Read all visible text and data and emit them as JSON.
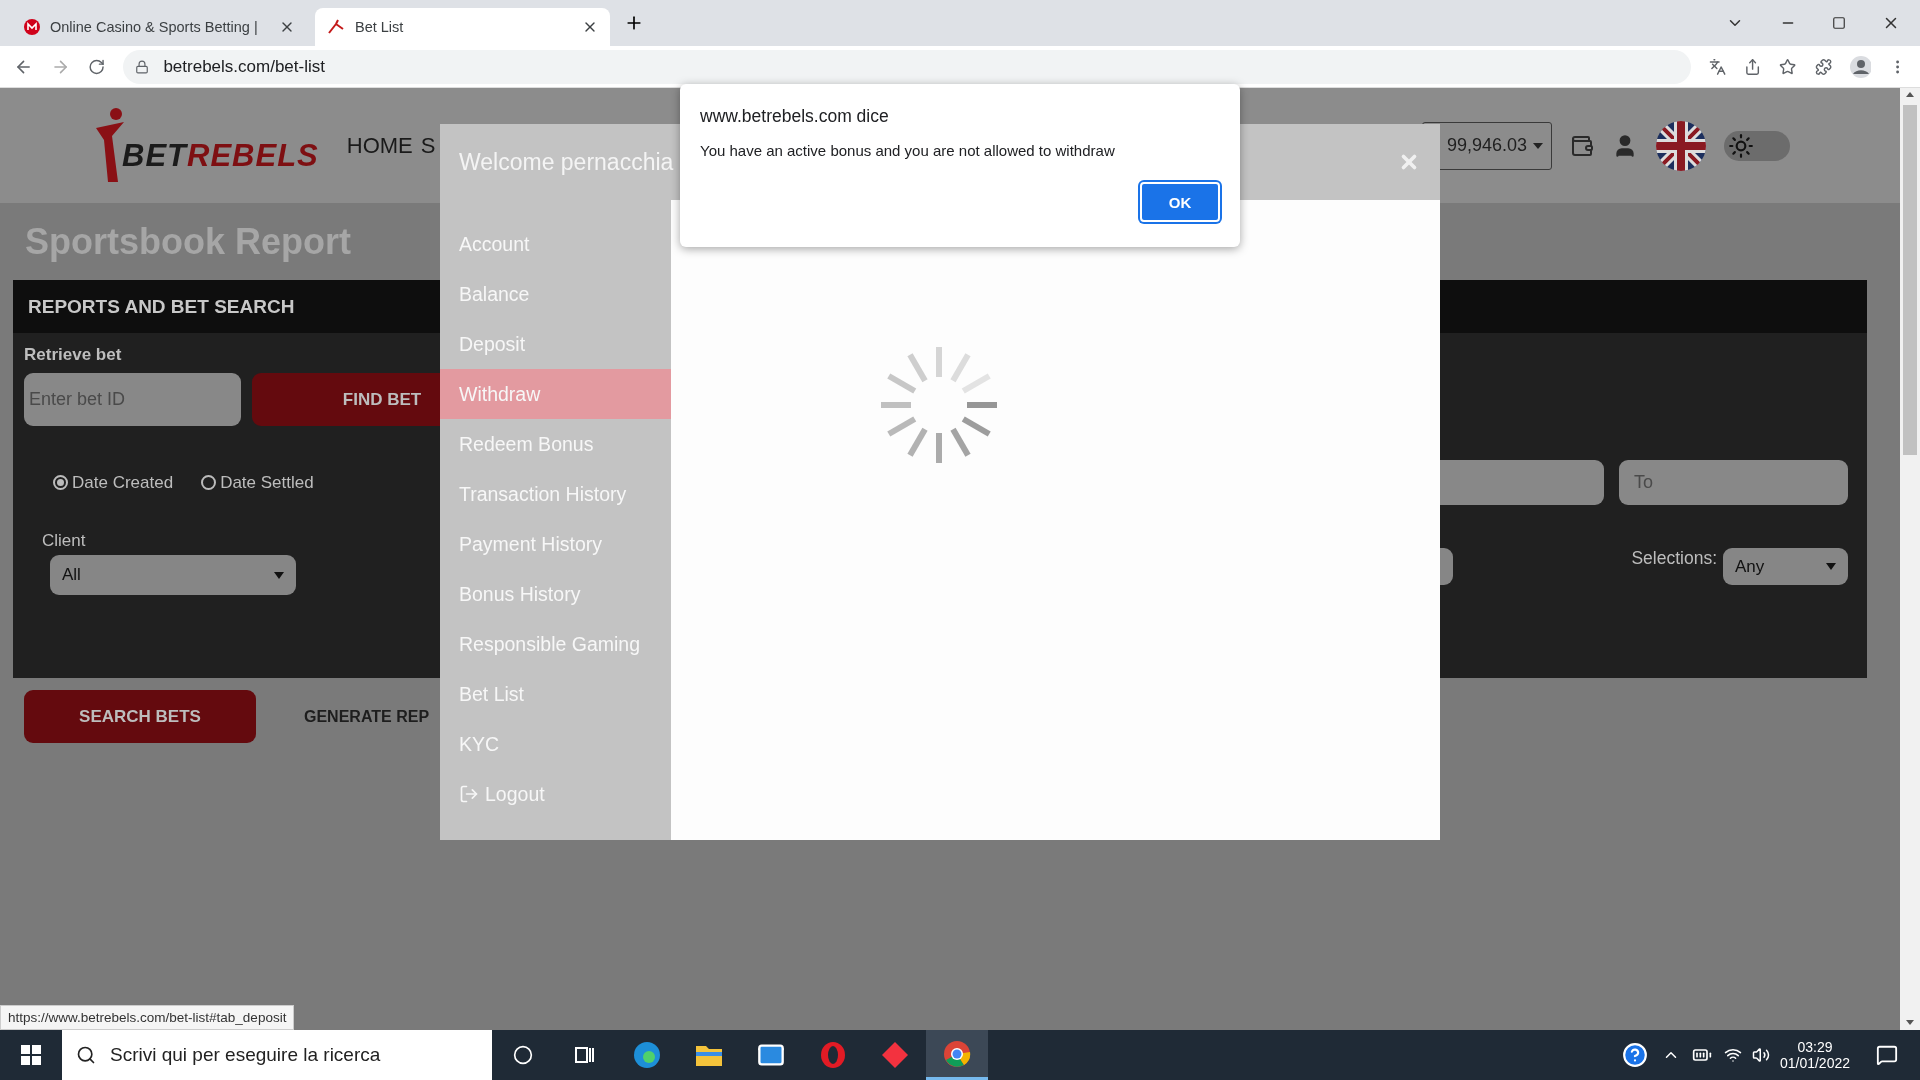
{
  "browser": {
    "tabs": [
      {
        "title": "Online Casino & Sports Betting |",
        "selected": false
      },
      {
        "title": "Bet List",
        "selected": true
      }
    ],
    "url": "betrebels.com/bet-list"
  },
  "header": {
    "brand": [
      "BET",
      "REBELS"
    ],
    "nav": [
      "HOME",
      "S"
    ],
    "balance": "99,946.03",
    "theme_toggle_on": false
  },
  "page": {
    "title": "Sportsbook Report",
    "panel_title": "REPORTS AND BET SEARCH",
    "retrieve_label": "Retrieve bet",
    "bet_id_placeholder": "Enter bet ID",
    "find_button": "FIND BET",
    "date_options": [
      {
        "label": "Date Created",
        "selected": true
      },
      {
        "label": "Date Settled",
        "selected": false
      }
    ],
    "to_placeholder": "To",
    "client_label": "Client",
    "client_value": "All",
    "selections_label": "Selections:",
    "selections_value": "Any",
    "search_button": "SEARCH BETS",
    "generate_button": "GENERATE REP"
  },
  "modal": {
    "title": "Welcome pernacchia",
    "menu": [
      {
        "label": "Account",
        "selected": false,
        "kind": "link"
      },
      {
        "label": "Balance",
        "selected": false,
        "kind": "link"
      },
      {
        "label": "Deposit",
        "selected": false,
        "kind": "link"
      },
      {
        "label": "Withdraw",
        "selected": true,
        "kind": "link"
      },
      {
        "label": "Redeem Bonus",
        "selected": false,
        "kind": "link"
      },
      {
        "label": "Transaction History",
        "selected": false,
        "kind": "link"
      },
      {
        "label": "Payment History",
        "selected": false,
        "kind": "link"
      },
      {
        "label": "Bonus History",
        "selected": false,
        "kind": "link"
      },
      {
        "label": "Responsible Gaming",
        "selected": false,
        "kind": "link"
      },
      {
        "label": "Bet List",
        "selected": false,
        "kind": "link"
      },
      {
        "label": "KYC",
        "selected": false,
        "kind": "link"
      },
      {
        "label": "Logout",
        "selected": false,
        "kind": "logout"
      }
    ]
  },
  "alert": {
    "title": "www.betrebels.com dice",
    "message": "You have an active bonus and you are not allowed to withdraw",
    "button": "OK"
  },
  "status_url": "https://www.betrebels.com/bet-list#tab_deposit",
  "taskbar": {
    "search_placeholder": "Scrivi qui per eseguire la ricerca",
    "time": "03:29",
    "date": "01/01/2022"
  }
}
